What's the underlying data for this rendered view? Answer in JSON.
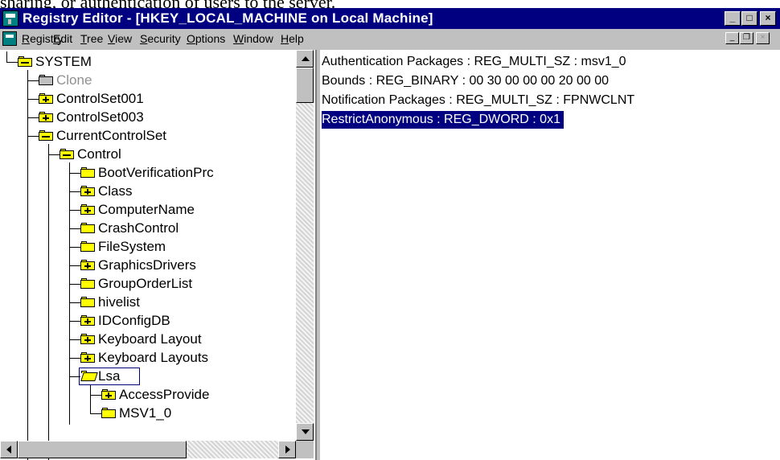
{
  "background_text": "sharing, or authentication of users to the server.",
  "window": {
    "title": "Registry Editor - [HKEY_LOCAL_MACHINE on Local Machine]",
    "caption_buttons": {
      "minimize": "_",
      "maximize": "□",
      "close": "×"
    },
    "mdi_buttons": {
      "minimize": "_",
      "restore": "❐",
      "close": "×"
    }
  },
  "menu": [
    {
      "accel": "R",
      "rest": "egistry"
    },
    {
      "accel": "E",
      "rest": "dit"
    },
    {
      "accel": "T",
      "rest": "ree"
    },
    {
      "accel": "V",
      "rest": "iew"
    },
    {
      "accel": "S",
      "rest": "ecurity"
    },
    {
      "pre": "",
      "accel": "O",
      "rest": "ptions"
    },
    {
      "accel": "W",
      "rest": "indow"
    },
    {
      "accel": "H",
      "rest": "elp"
    }
  ],
  "tree": [
    {
      "label": "SYSTEM",
      "icon": "folder-minus-icon"
    },
    {
      "label": "Clone",
      "icon": "folder-gray-icon",
      "dim": true
    },
    {
      "label": "ControlSet001",
      "icon": "folder-plus-icon"
    },
    {
      "label": "ControlSet003",
      "icon": "folder-plus-icon"
    },
    {
      "label": "CurrentControlSet",
      "icon": "folder-minus-icon"
    },
    {
      "label": "Control",
      "icon": "folder-minus-icon"
    },
    {
      "label": "BootVerificationPrc",
      "icon": "folder-icon"
    },
    {
      "label": "Class",
      "icon": "folder-plus-icon"
    },
    {
      "label": "ComputerName",
      "icon": "folder-plus-icon"
    },
    {
      "label": "CrashControl",
      "icon": "folder-icon"
    },
    {
      "label": "FileSystem",
      "icon": "folder-icon"
    },
    {
      "label": "GraphicsDrivers",
      "icon": "folder-plus-icon"
    },
    {
      "label": "GroupOrderList",
      "icon": "folder-icon"
    },
    {
      "label": "hivelist",
      "icon": "folder-icon"
    },
    {
      "label": "IDConfigDB",
      "icon": "folder-plus-icon"
    },
    {
      "label": "Keyboard Layout",
      "icon": "folder-plus-icon"
    },
    {
      "label": "Keyboard Layouts",
      "icon": "folder-plus-icon"
    },
    {
      "label": "Lsa",
      "icon": "folder-open-icon",
      "selected": true
    },
    {
      "label": "AccessProvide",
      "icon": "folder-plus-icon"
    },
    {
      "label": "MSV1_0",
      "icon": "folder-icon"
    }
  ],
  "values": [
    {
      "text": "Authentication Packages : REG_MULTI_SZ : msv1_0"
    },
    {
      "text": "Bounds : REG_BINARY : 00 30 00 00 00 20 00 00"
    },
    {
      "text": "Notification Packages : REG_MULTI_SZ : FPNWCLNT"
    },
    {
      "text": "RestrictAnonymous : REG_DWORD : 0x1",
      "selected": true
    }
  ],
  "colors": {
    "titlebar": "#000080",
    "selection": "#000080",
    "face": "#c0c0c0",
    "folder": "#ffff00"
  }
}
